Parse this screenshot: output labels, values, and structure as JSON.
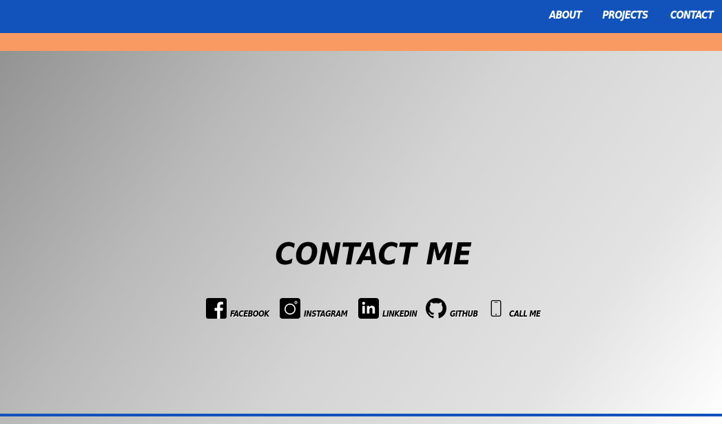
{
  "nav": {
    "items": [
      {
        "label": "About"
      },
      {
        "label": "Projects"
      },
      {
        "label": "Contact"
      }
    ]
  },
  "contact": {
    "title": "Contact Me",
    "links": [
      {
        "label": "Facebook",
        "icon": "facebook-icon"
      },
      {
        "label": "Instagram",
        "icon": "instagram-icon"
      },
      {
        "label": "LinkedIn",
        "icon": "linkedin-icon"
      },
      {
        "label": "GitHub",
        "icon": "github-icon"
      },
      {
        "label": "Call Me",
        "icon": "phone-icon"
      }
    ]
  },
  "colors": {
    "header": "#1152bb",
    "accent": "#f99a62",
    "text": "#000000"
  }
}
